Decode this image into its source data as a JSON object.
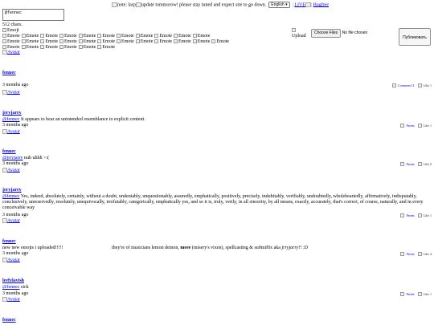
{
  "notice": {
    "broken_img_alt_1": "note: larp",
    "broken_img_alt_2": "update tommorow! please stay tuned and expect site to go down.",
    "language": "English",
    "live_label": "LIVE",
    "live_img_alt": "",
    "bugfree_label": "Bugfree"
  },
  "composer": {
    "textarea_value": "@fennec",
    "char_count": "512 chars.",
    "emoji_alt": "Emoji",
    "emote_alt": "Emote",
    "emote_rows": [
      11,
      12,
      6
    ],
    "upload_alt": "Upload",
    "choose_files": "Choose Files",
    "no_file": "No file chosen",
    "submit": "Публиковать"
  },
  "avatar_alt": "Avatar",
  "reply_alt": "Parent",
  "like_alt": "Like",
  "comment_alt": "Comment",
  "posts": [
    {
      "author": "fennec",
      "mention": "",
      "text": "",
      "text2": "",
      "time": "3 months ago",
      "comments": "11",
      "likes": "1",
      "top": true
    },
    {
      "author": "jrryjarry",
      "mention": "@fennec",
      "text": " It appears to bear an unintended resemblance to explicit content.",
      "text2": "",
      "time": "3 months ago",
      "likes": "1"
    },
    {
      "author": "fennec",
      "mention": "@jrryjarry",
      "text": " nuh uhhh >:(",
      "text2": "",
      "time": "3 months ago",
      "likes": "0"
    },
    {
      "author": "jrryjarry",
      "mention": "@fennec",
      "text": " Yes, indeed, absolutely, certainly, without a doubt, undeniably, unquestionably, assuredly, emphatically, positively, precisely, indubitably, verifiably, undoubtedly, wholeheartedly, affirmatively, indisputably, conclusively, unreservedly, resolutely, unequivocally, irrefutably, categorically, emphatically yes, and so it is, truly, verily, in all sincerity, by all means, exactly, accurately, that's correct, of course, naturally, and in every conceivable way",
      "text2": "",
      "time": "3 months ago",
      "likes": "1"
    },
    {
      "author": "fennec",
      "mention": "",
      "text": "new new emojis i uploaded!!!!!",
      "text2": "they're of musicians lemon demon, ",
      "bold": "meee",
      "text3": " (misery's vixen), spellcasting & su0mif0x aka ",
      "italic": "jrryjarry",
      "text4": "!! :D",
      "time": "3 months ago",
      "likes": "4"
    },
    {
      "author": "leefylavish",
      "mention": "@fennec",
      "text": " sick",
      "text2": "",
      "time": "3 months ago",
      "likes": "1"
    },
    {
      "author": "fennec",
      "mention": "",
      "text": "",
      "text2": "",
      "time": "",
      "likes": ""
    }
  ]
}
